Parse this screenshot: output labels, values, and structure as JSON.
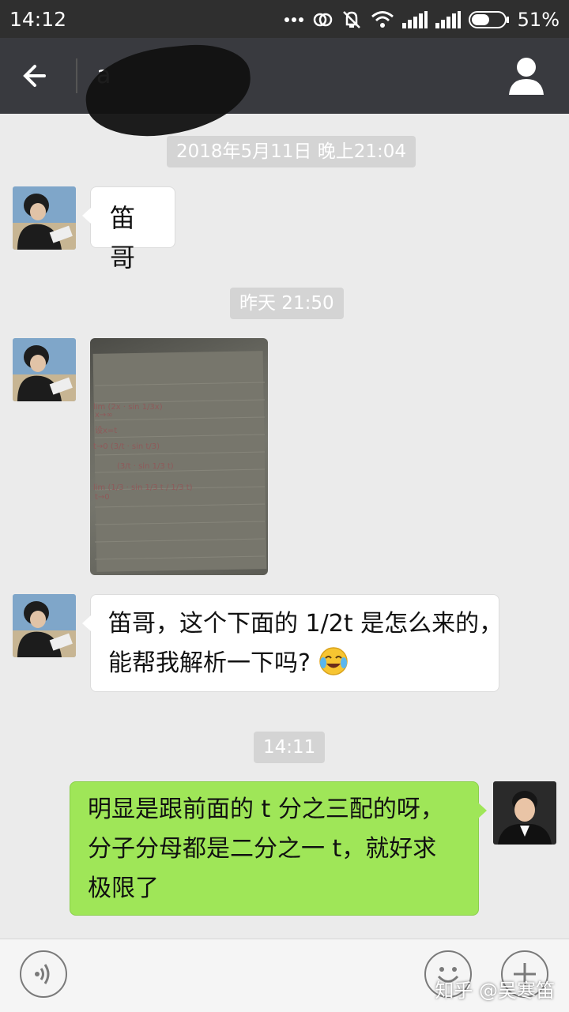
{
  "status": {
    "time": "14:12",
    "battery_percent": "51%",
    "icons": [
      "more-dots-icon",
      "sync-icon",
      "mute-icon",
      "wifi-icon",
      "signal-icon",
      "signal-icon",
      "battery-icon"
    ]
  },
  "header": {
    "title": "a",
    "back_icon": "back-arrow-icon",
    "profile_icon": "person-icon"
  },
  "chat": {
    "timestamps": [
      "2018年5月11日 晚上21:04",
      "昨天 21:50",
      "14:11"
    ],
    "messages": [
      {
        "side": "left",
        "type": "text",
        "text": "笛哥"
      },
      {
        "side": "left",
        "type": "image",
        "handwriting": [
          "lim (2x · sin 1/3x)",
          "x→∞",
          "设x=t",
          "t→0 (3/t · sin t/3)",
          "(3/t · sin 1/3 t)",
          "lim (1/3 · sin 1/3 t / 1/3 t)",
          "t→0"
        ]
      },
      {
        "side": "left",
        "type": "text",
        "lines": [
          "笛哥，这个下面的 1/2t 是怎么来的，",
          "能帮我解析一下吗?"
        ],
        "emoji": "crying-laughing-emoji"
      },
      {
        "side": "right",
        "type": "text",
        "lines": [
          "明显是跟前面的 t 分之三配的呀，",
          "分子分母都是二分之一 t，就好求",
          "极限了"
        ]
      }
    ]
  },
  "input_bar": {
    "voice_icon": "voice-icon",
    "emoji_icon": "emoji-icon",
    "add_icon": "plus-icon"
  },
  "watermark": "知乎 @吴寒笛",
  "colors": {
    "status_bg": "#2f2f2f",
    "header_bg": "#393a3f",
    "chat_bg": "#ebebeb",
    "my_bubble": "#9fe658",
    "their_bubble": "#ffffff"
  }
}
